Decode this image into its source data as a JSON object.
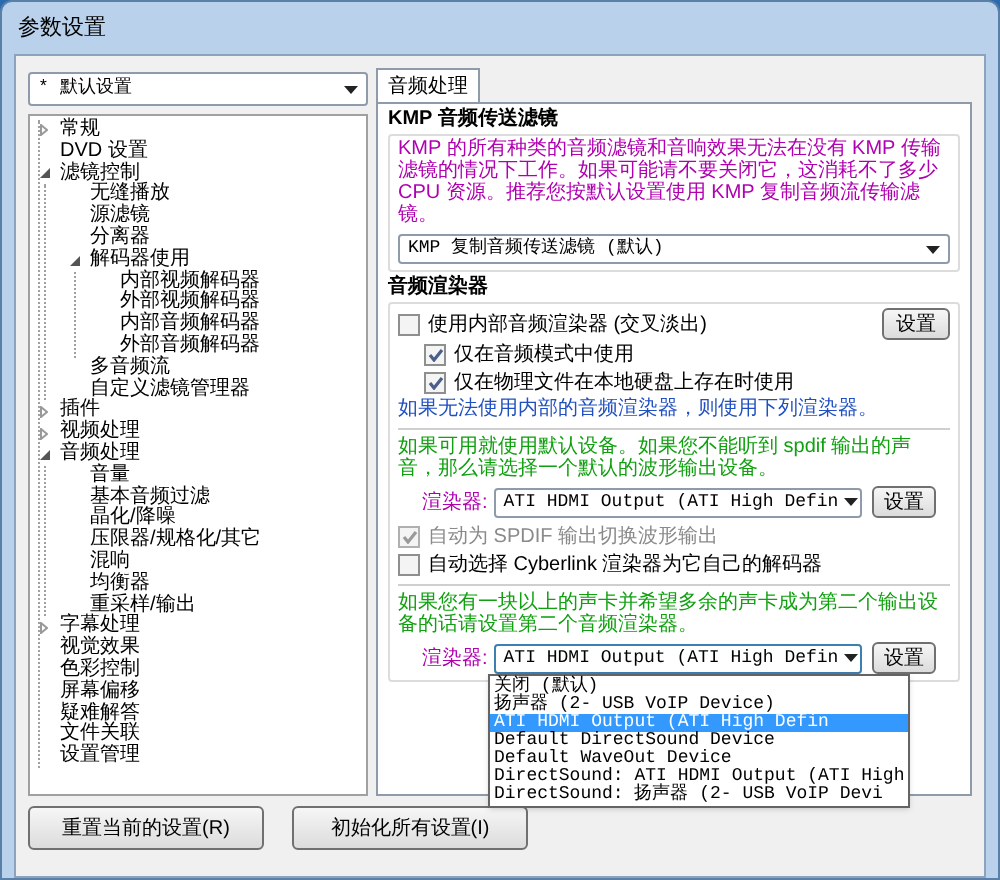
{
  "window": {
    "title": "参数设置"
  },
  "preset_select": {
    "value": "* 默认设置"
  },
  "tree": [
    {
      "label": "常规",
      "expanded": false,
      "selected": false
    },
    {
      "label": "DVD 设置",
      "selected": false
    },
    {
      "label": "滤镜控制",
      "expanded": true,
      "selected": false,
      "children": [
        {
          "label": "无缝播放",
          "selected": false
        },
        {
          "label": "源滤镜",
          "selected": false
        },
        {
          "label": "分离器",
          "selected": false
        },
        {
          "label": "解码器使用",
          "expanded": true,
          "selected": false,
          "children": [
            {
              "label": "内部视频解码器",
              "selected": false
            },
            {
              "label": "外部视频解码器",
              "selected": false
            },
            {
              "label": "内部音频解码器",
              "selected": false
            },
            {
              "label": "外部音频解码器",
              "selected": false
            }
          ]
        },
        {
          "label": "多音频流",
          "selected": false
        },
        {
          "label": "自定义滤镜管理器",
          "selected": false
        }
      ]
    },
    {
      "label": "插件",
      "expanded": false,
      "selected": false
    },
    {
      "label": "视频处理",
      "expanded": false,
      "selected": false
    },
    {
      "label": "音频处理",
      "expanded": true,
      "selected": false,
      "children": [
        {
          "label": "音量",
          "selected": false
        },
        {
          "label": "基本音频过滤",
          "selected": false
        },
        {
          "label": "晶化/降噪",
          "selected": false
        },
        {
          "label": "压限器/规格化/其它",
          "selected": false
        },
        {
          "label": "混响",
          "selected": false
        },
        {
          "label": "均衡器",
          "selected": false
        },
        {
          "label": "重采样/输出",
          "selected": false
        }
      ]
    },
    {
      "label": "字幕处理",
      "expanded": false,
      "selected": false
    },
    {
      "label": "视觉效果",
      "selected": false
    },
    {
      "label": "色彩控制",
      "selected": false
    },
    {
      "label": "屏幕偏移",
      "selected": false
    },
    {
      "label": "疑难解答",
      "selected": false
    },
    {
      "label": "文件关联",
      "selected": false
    },
    {
      "label": "设置管理",
      "selected": false
    }
  ],
  "tabs": [
    {
      "label": "音频处理",
      "selected": true
    }
  ],
  "transport_filter": {
    "title": "KMP 音频传送滤镜",
    "note": "KMP 的所有种类的音频滤镜和音响效果无法在没有 KMP 传输滤镜的情况下工作。如果可能请不要关闭它，这消耗不了多少 CPU 资源。推荐您按默认设置使用 KMP 复制音频流传输滤镜。",
    "select": {
      "value": "KMP 复制音频传送滤镜 (默认)"
    }
  },
  "audio_renderer": {
    "title": "音频渲染器",
    "button": "设置",
    "options": [
      {
        "label": "使用内部音频渲染器 (交叉淡出)",
        "checked": false,
        "disabled": false,
        "children": [
          {
            "label": "仅在音频模式中使用",
            "checked": true,
            "disabled": false
          },
          {
            "label": "仅在物理文件在本地硬盘上存在时使用",
            "checked": true,
            "disabled": false
          }
        ]
      }
    ],
    "fallback_note": "如果无法使用内部的音频渲染器，则使用下列渲染器。",
    "primary": {
      "note": "如果可用就使用默认设备。如果您不能听到 spdif 输出的声音，那么请选择一个默认的波形输出设备。",
      "label": "渲染器:",
      "select": {
        "value": "ATI HDMI Output (ATI High Defin"
      },
      "button": "设置",
      "options": [
        {
          "label": "自动为 SPDIF 输出切换波形输出",
          "checked": true,
          "disabled": true
        },
        {
          "label": "自动选择 Cyberlink 渲染器为它自己的解码器",
          "checked": false,
          "disabled": false
        }
      ]
    },
    "secondary": {
      "note": "如果您有一块以上的声卡并希望多余的声卡成为第二个输出设备的话请设置第二个音频渲染器。",
      "label": "渲染器:",
      "select": {
        "value": "ATI HDMI Output (ATI High Defin",
        "expanded": true,
        "options": [
          {
            "label": "关闭 (默认)",
            "selected": false
          },
          {
            "label": "扬声器 (2- USB VoIP Device)",
            "selected": false
          },
          {
            "label": "ATI HDMI Output (ATI High Defin",
            "selected": true
          },
          {
            "label": "Default DirectSound Device",
            "selected": false
          },
          {
            "label": "Default WaveOut Device",
            "selected": false
          },
          {
            "label": "DirectSound: ATI HDMI Output (ATI High",
            "selected": false
          },
          {
            "label": "DirectSound: 扬声器 (2- USB VoIP Devi",
            "selected": false
          }
        ]
      },
      "button": "设置"
    }
  },
  "buttons": [
    "重置当前的设置(R)",
    "初始化所有设置(I)"
  ]
}
